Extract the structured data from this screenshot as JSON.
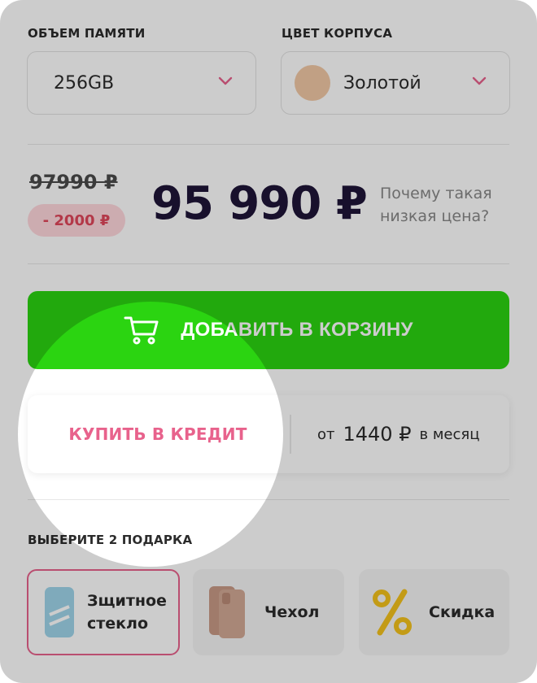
{
  "memory": {
    "label": "ОБЪЕМ ПАМЯТИ",
    "value": "256GB"
  },
  "color": {
    "label": "ЦВЕТ КОРПУСА",
    "value": "Золотой",
    "swatch_color": "#f2c9a6"
  },
  "pricing": {
    "old_price": "97990 ₽",
    "discount": "- 2000 ₽",
    "price": "95 990 ₽",
    "why_link": "Почему такая низкая цена?"
  },
  "cart": {
    "button_label": "ДОБАВИТЬ В КОРЗИНУ",
    "icon": "cart-icon",
    "color": "#2bd411"
  },
  "credit": {
    "button_label": "КУПИТЬ В КРЕДИТ",
    "monthly_prefix": "от",
    "monthly_amount": "1440 ₽",
    "monthly_suffix": "в месяц"
  },
  "gifts": {
    "label": "ВЫБЕРИТЕ 2 ПОДАРКА",
    "items": [
      {
        "name": "Зщитное стекло",
        "icon": "screen-protector-icon",
        "selected": true
      },
      {
        "name": "Чехол",
        "icon": "phone-case-icon",
        "selected": false
      },
      {
        "name": "Скидка",
        "icon": "percent-icon",
        "selected": false
      }
    ]
  },
  "colors": {
    "accent_pink": "#e8628c",
    "price_dark": "#1f1538",
    "discount_bg": "#ffd7dd"
  }
}
